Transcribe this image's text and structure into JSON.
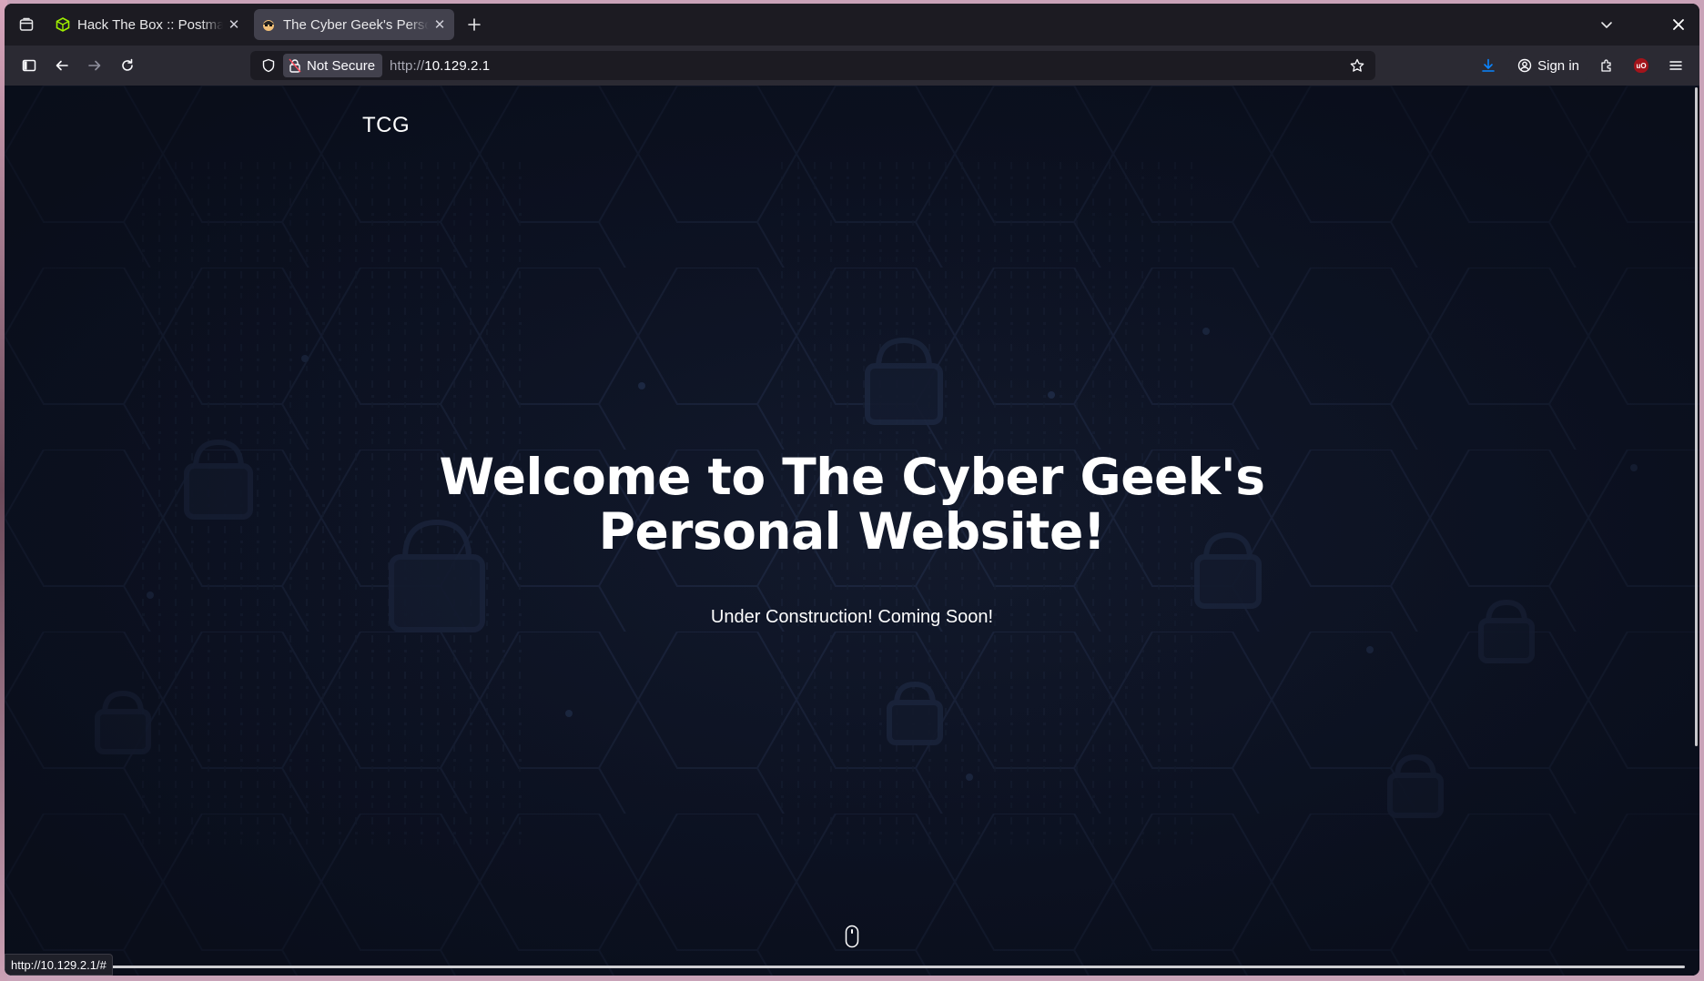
{
  "browser": {
    "tabs": [
      {
        "title": "Hack The Box :: Postman | Machine Info",
        "active": false,
        "favicon": "htb-cube-icon"
      },
      {
        "title": "The Cyber Geek's Personal Website",
        "active": true,
        "favicon": "hacker-face-icon"
      }
    ],
    "url": {
      "scheme": "http://",
      "host": "10.129.2.1"
    },
    "security_label": "Not Secure",
    "sign_in_label": "Sign in",
    "status_bar_link": "http://10.129.2.1/#"
  },
  "page": {
    "logo": "TCG",
    "title_line1": "Welcome to The Cyber Geek's",
    "title_line2": "Personal Website!",
    "subtitle": "Under Construction! Coming Soon!"
  },
  "colors": {
    "browser_bg": "#1c1b22",
    "toolbar_bg": "#2b2a33",
    "page_bg": "#0d1324",
    "text": "#ffffff"
  }
}
